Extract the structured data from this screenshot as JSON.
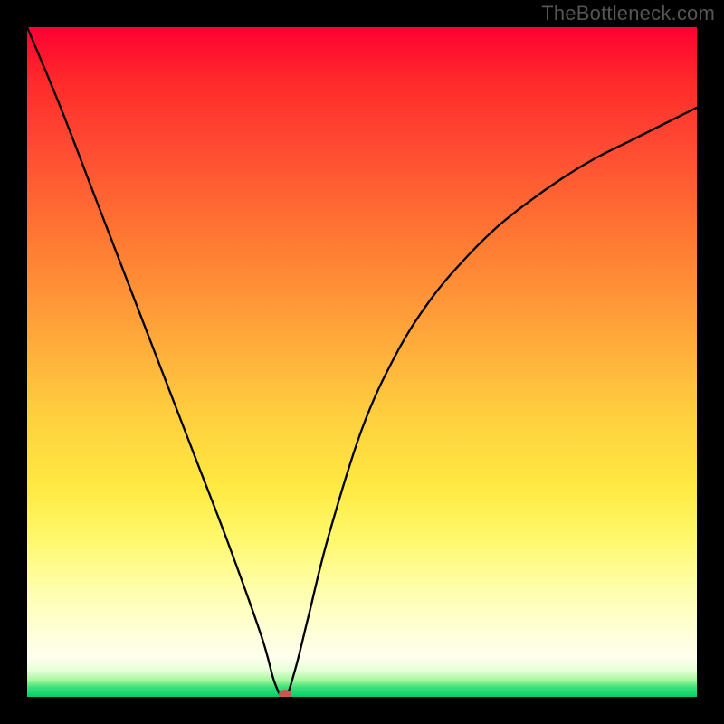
{
  "watermark": "TheBottleneck.com",
  "chart_data": {
    "type": "line",
    "title": "",
    "xlabel": "",
    "ylabel": "",
    "xlim": [
      0,
      100
    ],
    "ylim": [
      0,
      100
    ],
    "background_gradient": {
      "top": "#ff0033",
      "upper_mid": "#ffa43a",
      "mid": "#ffe840",
      "lower_mid": "#ffffd6",
      "bottom": "#00d06a"
    },
    "series": [
      {
        "name": "bottleneck-curve",
        "x": [
          0,
          5,
          10,
          15,
          20,
          25,
          30,
          35,
          37,
          38.5,
          40,
          42,
          45,
          50,
          55,
          60,
          65,
          70,
          75,
          80,
          85,
          90,
          95,
          100
        ],
        "y": [
          100,
          88,
          75,
          62,
          49,
          36,
          23,
          9,
          2,
          0,
          4,
          12,
          24,
          40,
          51,
          59,
          65,
          70,
          74,
          77.5,
          80.5,
          83,
          85.5,
          88
        ]
      }
    ],
    "min_point": {
      "x": 38.5,
      "y": 0
    },
    "legend": false,
    "grid": false
  }
}
